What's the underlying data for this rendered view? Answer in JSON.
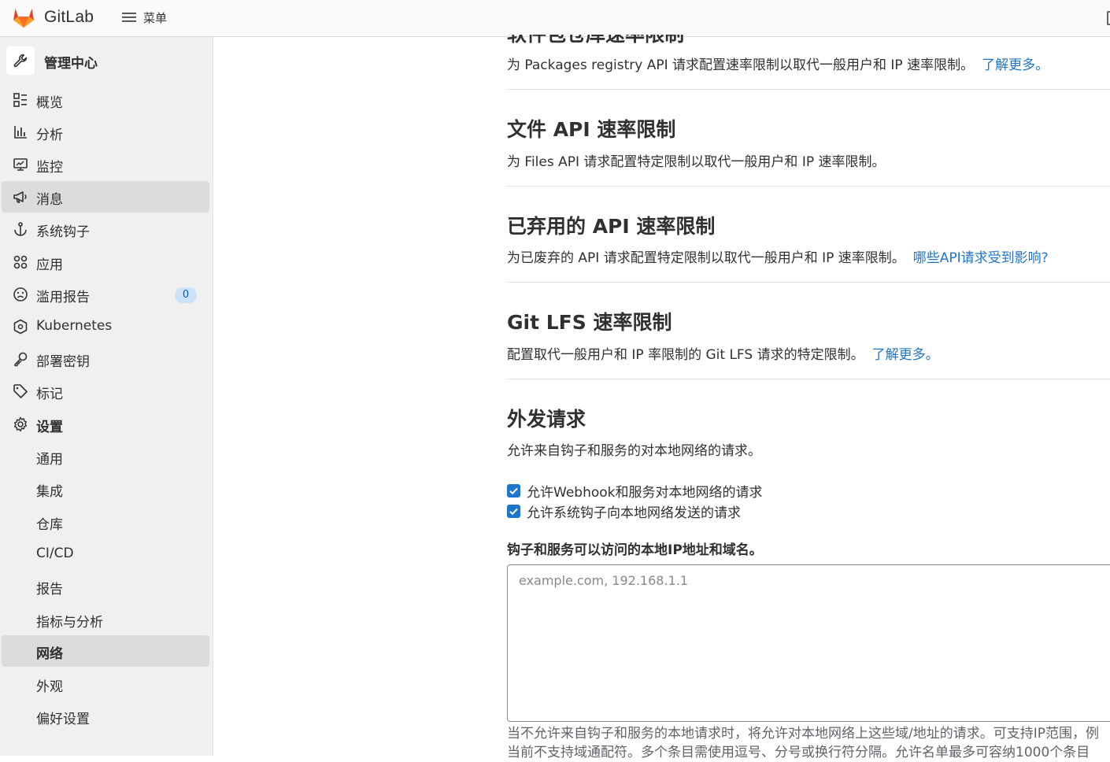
{
  "topbar": {
    "brand": "GitLab",
    "menu_label": "菜单"
  },
  "sidebar": {
    "title": "管理中心",
    "items": [
      {
        "label": "概览",
        "icon": "overview-icon"
      },
      {
        "label": "分析",
        "icon": "chart-icon"
      },
      {
        "label": "监控",
        "icon": "monitor-icon"
      },
      {
        "label": "消息",
        "icon": "bullhorn-icon"
      },
      {
        "label": "系统钩子",
        "icon": "anchor-icon"
      },
      {
        "label": "应用",
        "icon": "applications-icon"
      },
      {
        "label": "滥用报告",
        "icon": "sad-face-icon",
        "badge": "0"
      },
      {
        "label": "Kubernetes",
        "icon": "kubernetes-icon"
      },
      {
        "label": "部署密钥",
        "icon": "key-icon"
      },
      {
        "label": "标记",
        "icon": "label-icon"
      },
      {
        "label": "设置",
        "icon": "settings-icon"
      }
    ],
    "settings_subitems": [
      {
        "label": "通用"
      },
      {
        "label": "集成"
      },
      {
        "label": "仓库"
      },
      {
        "label": "CI/CD"
      },
      {
        "label": "报告"
      },
      {
        "label": "指标与分析"
      },
      {
        "label": "网络"
      },
      {
        "label": "外观"
      },
      {
        "label": "偏好设置"
      }
    ]
  },
  "content": {
    "packages": {
      "title": "软件包仓库速率限制",
      "desc": "为 Packages registry API 请求配置速率限制以取代一般用户和 IP 速率限制。",
      "link": "了解更多。"
    },
    "files_api": {
      "title": "文件 API 速率限制",
      "desc": "为 Files API 请求配置特定限制以取代一般用户和 IP 速率限制。"
    },
    "deprecated_api": {
      "title": "已弃用的 API 速率限制",
      "desc": "为已废弃的 API 请求配置特定限制以取代一般用户和 IP 速率限制。",
      "link": "哪些API请求受到影响?"
    },
    "git_lfs": {
      "title": "Git LFS 速率限制",
      "desc": "配置取代一般用户和 IP 率限制的 Git LFS 请求的特定限制。",
      "link": "了解更多。"
    },
    "outbound": {
      "title": "外发请求",
      "desc": "允许来自钩子和服务的对本地网络的请求。",
      "checkbox_webhook": "允许Webhook和服务对本地网络的请求",
      "checkbox_system_hooks": "允许系统钩子向本地网络发送的请求",
      "allowlist_label": "钩子和服务可以访问的本地IP地址和域名。",
      "allowlist_placeholder": "example.com, 192.168.1.1",
      "help_line1": "当不允许来自钩子和服务的本地请求时，将允许对本地网络上这些域/地址的请求。可支持IP范围，例",
      "help_line2": "当前不支持域通配符。多个条目需使用逗号、分号或换行符分隔。允许名单最多可容纳1000个条目"
    }
  },
  "colors": {
    "accent": "#1f75cb",
    "sidebar_bg": "#f0f0f0",
    "active_bg": "#dcdcde",
    "badge_bg": "#cbe2f9"
  }
}
